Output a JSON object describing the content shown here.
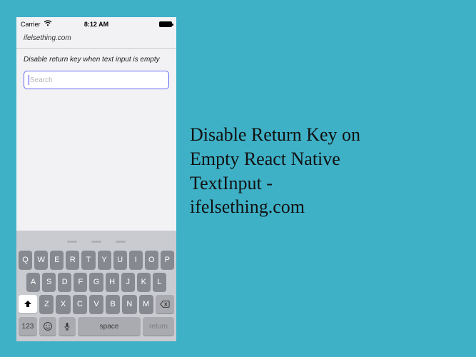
{
  "statusBar": {
    "carrier": "Carrier",
    "time": "8:12 AM"
  },
  "app": {
    "header": "ifelsething.com",
    "subtitle": "Disable return key when text input is empty",
    "searchPlaceholder": "Search"
  },
  "keyboard": {
    "row1": [
      "Q",
      "W",
      "E",
      "R",
      "T",
      "Y",
      "U",
      "I",
      "O",
      "P"
    ],
    "row2": [
      "A",
      "S",
      "D",
      "F",
      "G",
      "H",
      "J",
      "K",
      "L"
    ],
    "row3": [
      "Z",
      "X",
      "C",
      "V",
      "B",
      "N",
      "M"
    ],
    "numKey": "123",
    "space": "space",
    "return": "return"
  },
  "headline": {
    "l1": "Disable Return Key on",
    "l2": "Empty React Native",
    "l3": "TextInput -",
    "l4": "ifelsething.com"
  }
}
